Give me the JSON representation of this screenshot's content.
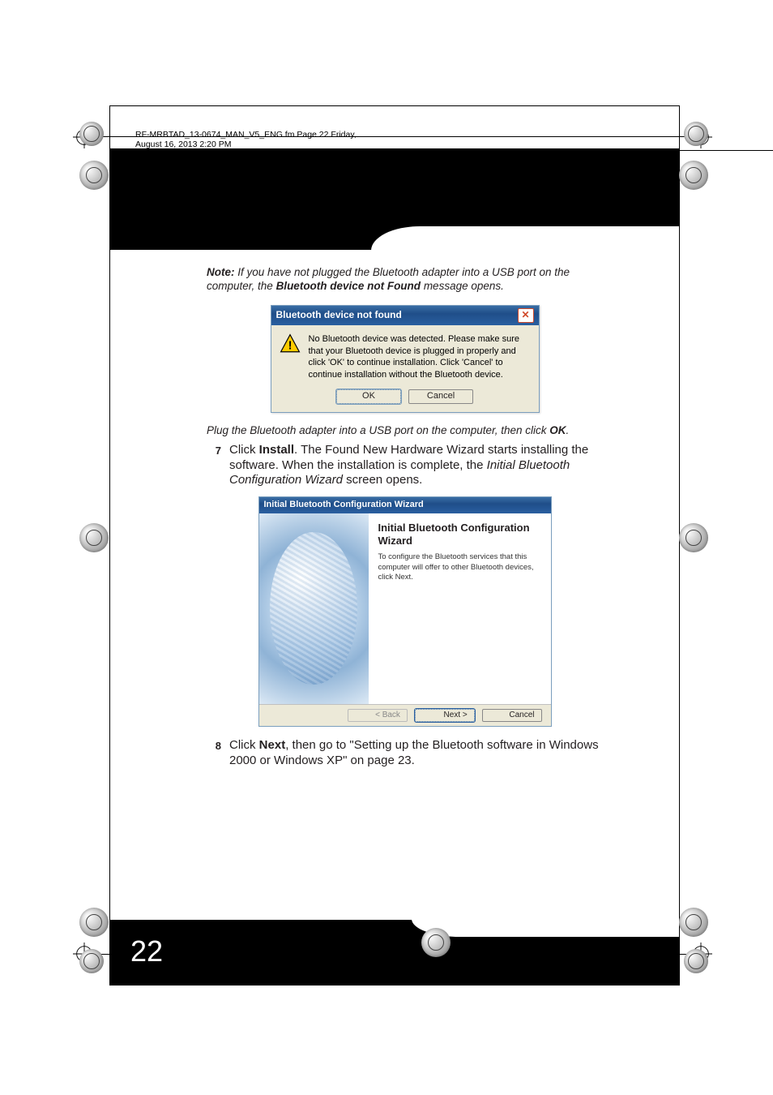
{
  "header_line": "RF-MRBTAD_13-0674_MAN_V5_ENG.fm  Page 22  Friday, August 16, 2013  2:20 PM",
  "page_number": "22",
  "note": {
    "label": "Note:",
    "text_before": " If you have not plugged the Bluetooth adapter into a USB port on the computer, the ",
    "bold_inline": "Bluetooth device not Found",
    "text_after": " message opens."
  },
  "dialog1": {
    "title": "Bluetooth device not found",
    "message": "No Bluetooth device was detected. Please make sure that your Bluetooth device is plugged in properly and click 'OK' to continue installation. Click 'Cancel' to continue installation without the Bluetooth device.",
    "ok": "OK",
    "cancel": "Cancel"
  },
  "plug_line": {
    "text": "Plug the Bluetooth adapter into a USB port on the computer, then click ",
    "bold": "OK",
    "tail": "."
  },
  "step7": {
    "num": "7",
    "pre": "Click ",
    "bold1": "Install",
    "mid": ". The Found New Hardware Wizard starts installing the software. When the installation is complete, the ",
    "italic": "Initial Bluetooth Configuration Wizard",
    "post": " screen opens."
  },
  "dialog2": {
    "title": "Initial Bluetooth Configuration Wizard",
    "heading": "Initial Bluetooth Configuration Wizard",
    "body": "To configure the Bluetooth services that this computer will offer to other Bluetooth devices, click Next.",
    "back": "< Back",
    "next": "Next >",
    "cancel": "Cancel"
  },
  "step8": {
    "num": "8",
    "pre": "Click ",
    "bold1": "Next",
    "post": ", then go to \"Setting up the Bluetooth software in Windows 2000 or Windows XP\" on page 23."
  }
}
